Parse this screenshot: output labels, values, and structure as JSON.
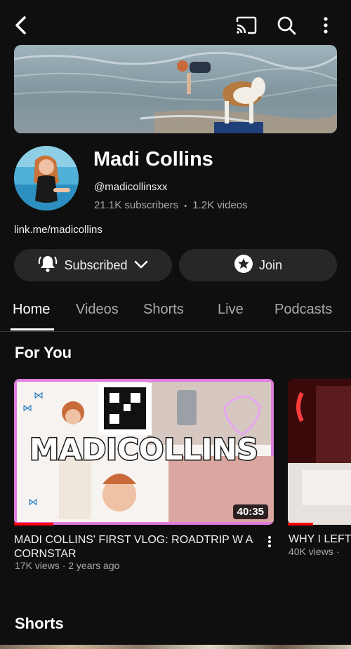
{
  "channel": {
    "name": "Madi Collins",
    "handle": "@madicollinsxx",
    "subscribers": "21.1K subscribers",
    "separator": "•",
    "videos": "1.2K videos",
    "link": "link.me/madicollins"
  },
  "buttons": {
    "subscribed": "Subscribed",
    "join": "Join"
  },
  "tabs": [
    "Home",
    "Videos",
    "Shorts",
    "Live",
    "Podcasts"
  ],
  "sections": {
    "for_you": "For You",
    "shorts": "Shorts"
  },
  "videos": [
    {
      "title": "MADI COLLINS' FIRST VLOG: ROADTRIP W A CORNSTAR",
      "meta": "17K views · 2 years ago",
      "duration": "40:35",
      "thumb_text": "MADICOLLINS"
    },
    {
      "title": "WHY I LEFT",
      "meta": "40K views ·"
    }
  ],
  "icons": {
    "back": "back-arrow-icon",
    "cast": "cast-icon",
    "search": "search-icon",
    "more": "more-vert-icon",
    "bell": "bell-icon",
    "chevron": "chevron-down-icon",
    "star": "star-icon"
  },
  "colors": {
    "background": "#0f0f0f",
    "button": "#272727",
    "progress": "#ff0000",
    "thumb_border": "#e07be0"
  }
}
